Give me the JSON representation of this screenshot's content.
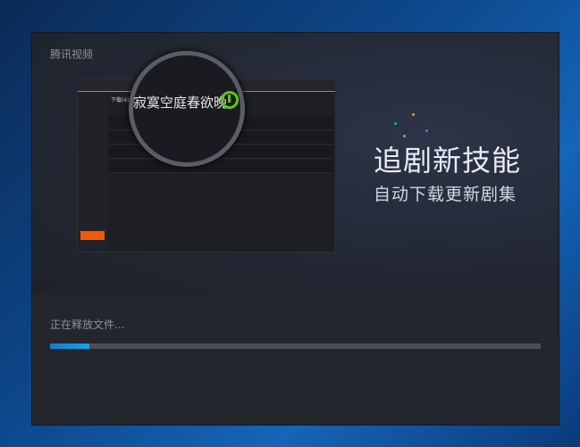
{
  "window": {
    "title": "腾讯视频"
  },
  "promo": {
    "headline": "追剧新技能",
    "subline": "自动下载更新剧集",
    "magnified_title": "寂寞空庭春欲晚",
    "screenshot_header": "下载(4)"
  },
  "install": {
    "status": "正在释放文件...",
    "progress_percent": 8
  },
  "colors": {
    "accent": "#12a6f0",
    "download_green": "#5fc41c",
    "active_tab": "#f25a0a"
  }
}
